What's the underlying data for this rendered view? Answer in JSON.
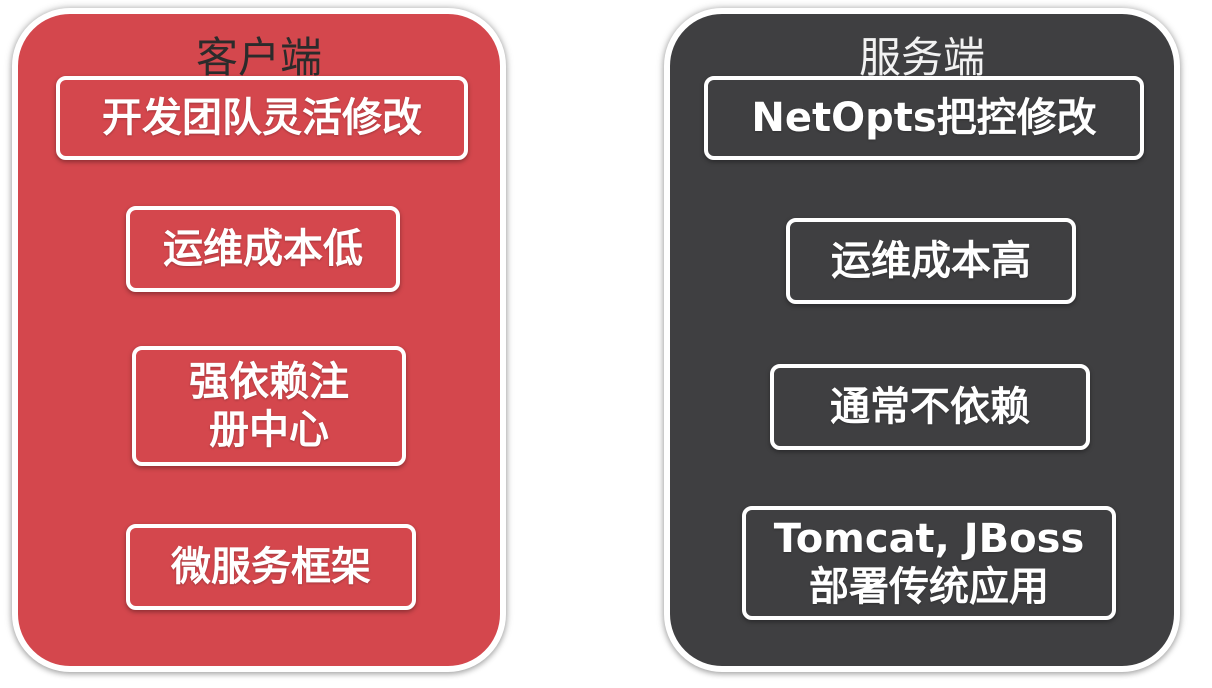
{
  "client": {
    "title": "客户端",
    "items": [
      {
        "lines": [
          "开发团队灵活修改"
        ]
      },
      {
        "lines": [
          "运维成本低"
        ]
      },
      {
        "lines": [
          "强依赖注",
          "册中心"
        ]
      },
      {
        "lines": [
          "微服务框架"
        ]
      }
    ]
  },
  "server": {
    "title": "服务端",
    "items": [
      {
        "lines": [
          "NetOpts把控修改"
        ]
      },
      {
        "lines": [
          "运维成本高"
        ]
      },
      {
        "lines": [
          "通常不依赖"
        ]
      },
      {
        "lines": [
          "Tomcat, JBoss",
          "部署传统应用"
        ]
      }
    ]
  },
  "colors": {
    "client_panel": "#d4474d",
    "server_panel": "#3f3f41",
    "border": "#ffffff"
  }
}
